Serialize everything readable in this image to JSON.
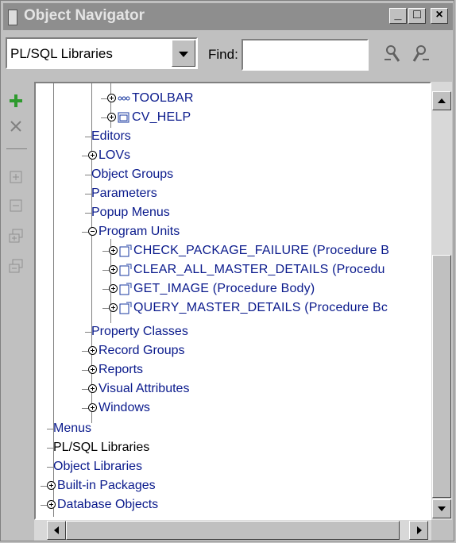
{
  "window": {
    "title": "Object Navigator",
    "buttons": {
      "minimize": "_",
      "maximize": "□",
      "close": "×"
    }
  },
  "toolbar": {
    "combo_value": "PL/SQL Libraries",
    "find_label": "Find:",
    "find_value": ""
  },
  "tree": {
    "nodes": [
      {
        "label": "TOOLBAR",
        "expand": "plus",
        "icon": "canvas-icon"
      },
      {
        "label": "CV_HELP",
        "expand": "plus",
        "icon": "form-icon"
      },
      {
        "label": "Editors"
      },
      {
        "label": "LOVs",
        "expand": "plus"
      },
      {
        "label": "Object Groups"
      },
      {
        "label": "Parameters"
      },
      {
        "label": "Popup Menus"
      },
      {
        "label": "Program Units",
        "expand": "minus"
      },
      {
        "label": "CHECK_PACKAGE_FAILURE (Procedure B",
        "expand": "plus",
        "icon": "procedure-icon"
      },
      {
        "label": "CLEAR_ALL_MASTER_DETAILS (Procedu",
        "expand": "plus",
        "icon": "procedure-icon"
      },
      {
        "label": "GET_IMAGE (Procedure Body)",
        "expand": "plus",
        "icon": "procedure-icon"
      },
      {
        "label": "QUERY_MASTER_DETAILS (Procedure Bc",
        "expand": "plus",
        "icon": "procedure-icon"
      },
      {
        "label": "Property Classes"
      },
      {
        "label": "Record Groups",
        "expand": "plus"
      },
      {
        "label": "Reports",
        "expand": "plus"
      },
      {
        "label": "Visual Attributes",
        "expand": "plus"
      },
      {
        "label": "Windows",
        "expand": "plus"
      },
      {
        "label": "Menus"
      },
      {
        "label": "PL/SQL Libraries"
      },
      {
        "label": "Object Libraries"
      },
      {
        "label": "Built-in Packages",
        "expand": "plus"
      },
      {
        "label": "Database Objects",
        "expand": "plus"
      }
    ]
  },
  "colors": {
    "node_text": "#0a1a8c",
    "selected_text": "#000000",
    "titlebar": "#8e8e8e"
  }
}
